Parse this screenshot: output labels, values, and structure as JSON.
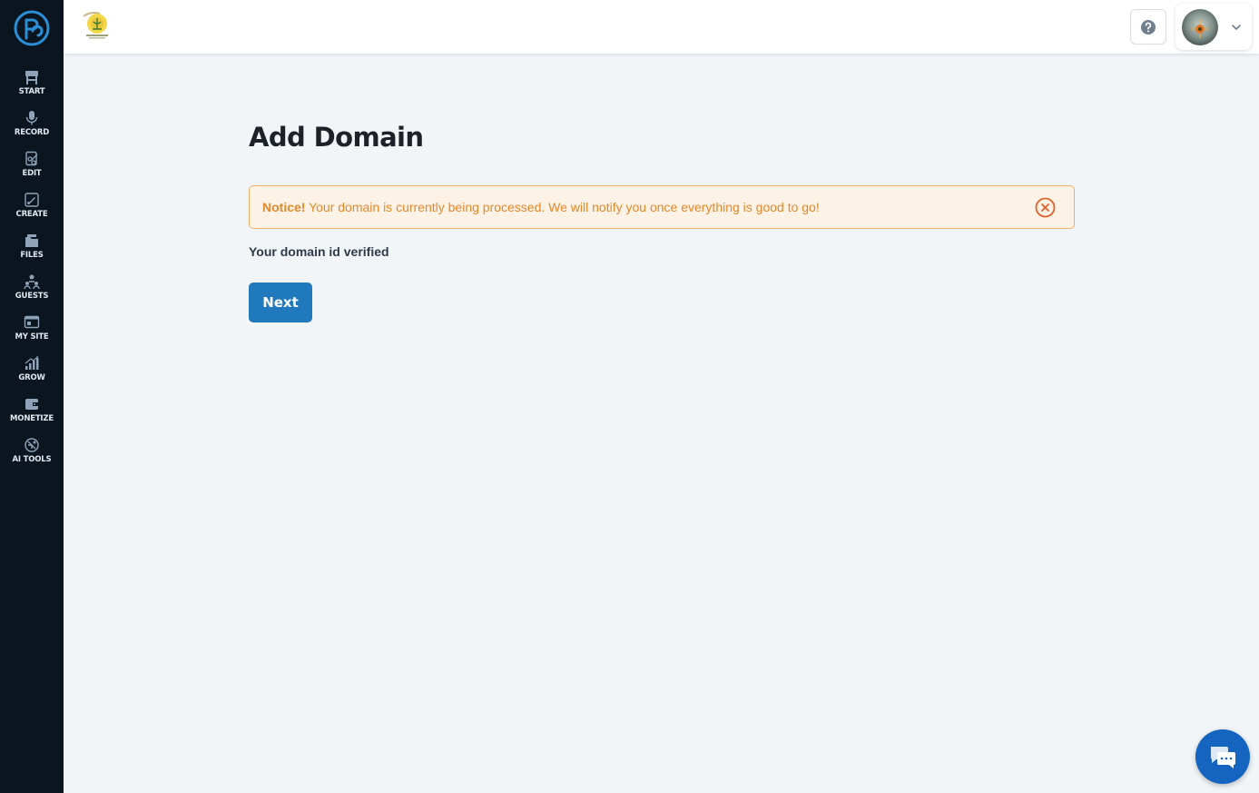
{
  "sidebar": {
    "items": [
      {
        "label": "START",
        "icon": "start-icon"
      },
      {
        "label": "RECORD",
        "icon": "microphone-icon"
      },
      {
        "label": "EDIT",
        "icon": "edit-icon"
      },
      {
        "label": "CREATE",
        "icon": "create-icon"
      },
      {
        "label": "FILES",
        "icon": "files-icon"
      },
      {
        "label": "GUESTS",
        "icon": "guests-icon"
      },
      {
        "label": "MY SITE",
        "icon": "site-icon"
      },
      {
        "label": "GROW",
        "icon": "grow-icon"
      },
      {
        "label": "MONETIZE",
        "icon": "monetize-icon"
      },
      {
        "label": "AI TOOLS",
        "icon": "ai-tools-icon"
      }
    ]
  },
  "main": {
    "title": "Add Domain",
    "notice": {
      "strong": "Notice!",
      "message": " Your domain is currently being processed. We will notify you once everything is good to go!"
    },
    "status": "Your domain id verified",
    "next_label": "Next"
  },
  "colors": {
    "sidebar_bg": "#0b1520",
    "accent": "#2179bd",
    "notice_text": "#e5882a",
    "notice_bg": "#fdf2e6",
    "chat": "#1565c0"
  }
}
